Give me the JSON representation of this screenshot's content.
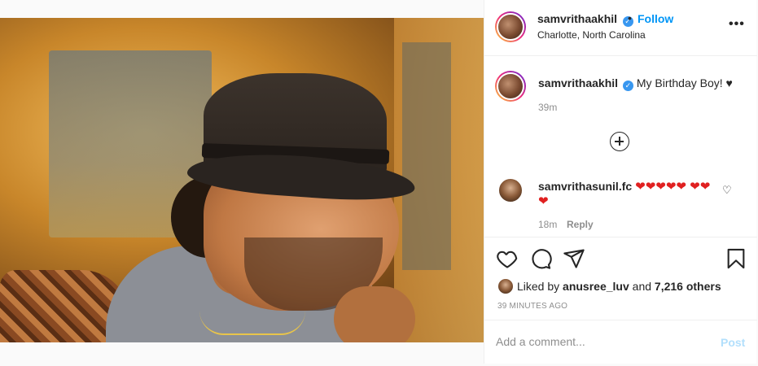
{
  "post": {
    "author": "samvrithaakhil",
    "verified_badge": "✓",
    "dot": "•",
    "follow_label": "Follow",
    "location": "Charlotte, North Carolina",
    "more_label": "•••"
  },
  "caption": {
    "username": "samvrithaakhil",
    "text": "My Birthday Boy! ♥",
    "time": "39m"
  },
  "comment": {
    "username": "samvrithasunil.fc",
    "text": "❤❤❤❤❤ ❤❤❤",
    "time": "18m",
    "reply_label": "Reply",
    "like_icon": "♡"
  },
  "likes": {
    "prefix": "Liked by ",
    "user": "anusree_luv",
    "middle": " and ",
    "count": "7,216 others"
  },
  "post_age": "39 MINUTES AGO",
  "add_comment": {
    "placeholder": "Add a comment...",
    "post_label": "Post"
  },
  "icons": {
    "like": "heart-icon",
    "comment": "comment-icon",
    "share": "share-icon",
    "save": "bookmark-icon",
    "load_more": "plus-circle-icon"
  },
  "colors": {
    "link_blue": "#0095f6",
    "verified_blue": "#3897f0",
    "heart_red": "#e02020",
    "post_disabled": "#b2dffc"
  }
}
